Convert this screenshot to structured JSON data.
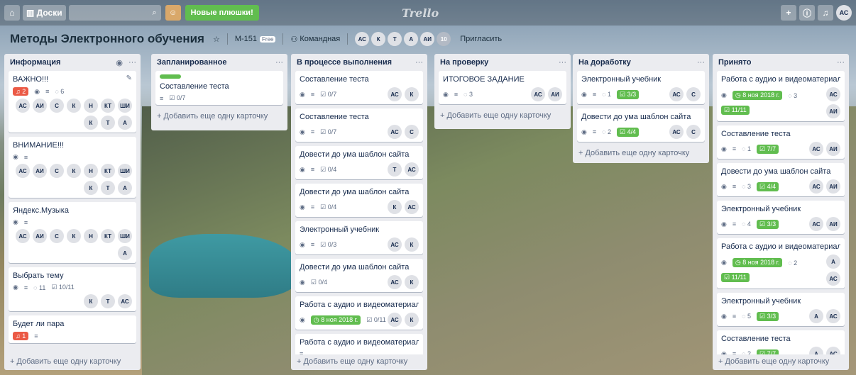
{
  "topbar": {
    "home_icon": "home-icon",
    "boards_label": "Доски",
    "new_stuff": "Новые плюшки!",
    "logo": "Trello",
    "avatar": "АС"
  },
  "board": {
    "title": "Методы Электронного обучения",
    "team": "М-151",
    "free": "Free",
    "visibility": "Командная",
    "members": [
      "АС",
      "К",
      "Т",
      "А",
      "АИ"
    ],
    "more_members": "10",
    "invite": "Пригласить"
  },
  "add_card_label": "+ Добавить еще одну карточку",
  "lists": [
    {
      "title": "Информация",
      "cards": [
        {
          "title": "ВАЖНО!!!",
          "red": "2",
          "comments": "6",
          "members": [
            "АС",
            "АИ",
            "С",
            "К",
            "Н",
            "КТ",
            "ШИ",
            "К",
            "Т",
            "А"
          ]
        },
        {
          "title": "ВНИМАНИЕ!!!",
          "members": [
            "АС",
            "АИ",
            "С",
            "К",
            "Н",
            "КТ",
            "ШИ",
            "К",
            "Т",
            "А"
          ]
        },
        {
          "title": "Яндекс.Музыка",
          "members": [
            "АС",
            "АИ",
            "С",
            "К",
            "Н",
            "КТ",
            "ШИ",
            "А"
          ]
        },
        {
          "title": "Выбрать тему",
          "comments": "11",
          "check": "10/11",
          "members": [
            "К",
            "Т",
            "АС"
          ]
        },
        {
          "title": "Будет ли пара",
          "red": "1"
        }
      ]
    },
    {
      "title": "Запланированное",
      "cards": [
        {
          "title": "Составление теста",
          "check": "0/7"
        }
      ]
    },
    {
      "title": "В процессе выполнения",
      "cards": [
        {
          "title": "Составление теста",
          "check": "0/7",
          "members": [
            "АС",
            "К"
          ]
        },
        {
          "title": "Составление теста",
          "check": "0/7",
          "members": [
            "АС",
            "С"
          ]
        },
        {
          "title": "Довести до ума шаблон сайта",
          "check": "0/4",
          "members": [
            "Т",
            "АС"
          ]
        },
        {
          "title": "Довести до ума шаблон сайта",
          "check": "0/4",
          "members": [
            "К",
            "АС"
          ]
        },
        {
          "title": "Электронный учебник",
          "check": "0/3",
          "members": [
            "АС",
            "К"
          ]
        },
        {
          "title": "Довести до ума шаблон сайта",
          "check": "0/4",
          "members": [
            "АС",
            "К"
          ]
        },
        {
          "title": "Работа с аудио и видеоматериалом",
          "due": "8 ноя 2018 г.",
          "check": "0/11",
          "members": [
            "АС",
            "К"
          ]
        },
        {
          "title": "Работа с аудио и видеоматериалом"
        }
      ]
    },
    {
      "title": "На проверку",
      "cards": [
        {
          "title": "ИТОГОВОЕ ЗАДАНИЕ",
          "comments": "3",
          "members": [
            "АС",
            "АИ"
          ]
        }
      ]
    },
    {
      "title": "На доработку",
      "cards": [
        {
          "title": "Электронный учебник",
          "comments": "1",
          "check": "3/3",
          "members": [
            "АС",
            "С"
          ]
        },
        {
          "title": "Довести до ума шаблон сайта",
          "comments": "2",
          "check": "4/4",
          "members": [
            "АС",
            "С"
          ]
        }
      ]
    },
    {
      "title": "Принято",
      "cards": [
        {
          "title": "Работа с аудио и видеоматериалом",
          "due": "8 ноя 2018 г.",
          "comments": "3",
          "check": "11/11",
          "members": [
            "АС",
            "АИ"
          ]
        },
        {
          "title": "Составление теста",
          "comments": "1",
          "check": "7/7",
          "members": [
            "АС",
            "АИ"
          ]
        },
        {
          "title": "Довести до ума шаблон сайта",
          "comments": "3",
          "check": "4/4",
          "members": [
            "АС",
            "АИ"
          ]
        },
        {
          "title": "Электронный учебник",
          "comments": "4",
          "check": "3/3",
          "members": [
            "АС",
            "АИ"
          ]
        },
        {
          "title": "Работа с аудио и видеоматериалом",
          "due": "8 ноя 2018 г.",
          "comments": "2",
          "check": "11/11",
          "members": [
            "А",
            "АС"
          ]
        },
        {
          "title": "Электронный учебник",
          "comments": "5",
          "check": "3/3",
          "members": [
            "А",
            "АС"
          ]
        },
        {
          "title": "Составление теста",
          "comments": "2",
          "check": "7/7",
          "members": [
            "А",
            "АС"
          ]
        }
      ]
    }
  ]
}
